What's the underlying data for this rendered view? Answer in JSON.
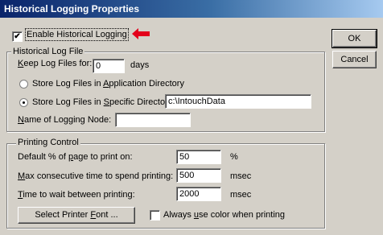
{
  "window": {
    "title": "Historical Logging Properties"
  },
  "enable_logging": {
    "label": "Enable Historical Logging",
    "checked": true
  },
  "annotation": {
    "color": "#e3001b"
  },
  "buttons": {
    "ok": "OK",
    "cancel": "Cancel"
  },
  "log_file_group": {
    "title": "Historical Log File",
    "keep_label": "Keep Log Files for:",
    "keep_value": "0",
    "keep_unit": "days",
    "radio_app_dir": "Store Log Files in Application Directory",
    "radio_specific_dir": "Store Log Files in Specific Directory:",
    "selected_option": "specific",
    "directory_value": "c:\\IntouchData",
    "node_label": "Name of Logging Node:",
    "node_value": ""
  },
  "printing_group": {
    "title": "Printing Control",
    "default_page_label": "Default % of page to print on:",
    "default_page_value": "50",
    "default_page_unit": "%",
    "max_time_label": "Max consecutive time to spend printing:",
    "max_time_value": "500",
    "max_time_unit": "msec",
    "wait_label": "Time to wait between printing:",
    "wait_value": "2000",
    "wait_unit": "msec",
    "select_font_button": "Select Printer Font ...",
    "always_color_label": "Always use color when printing",
    "always_color_checked": false
  }
}
